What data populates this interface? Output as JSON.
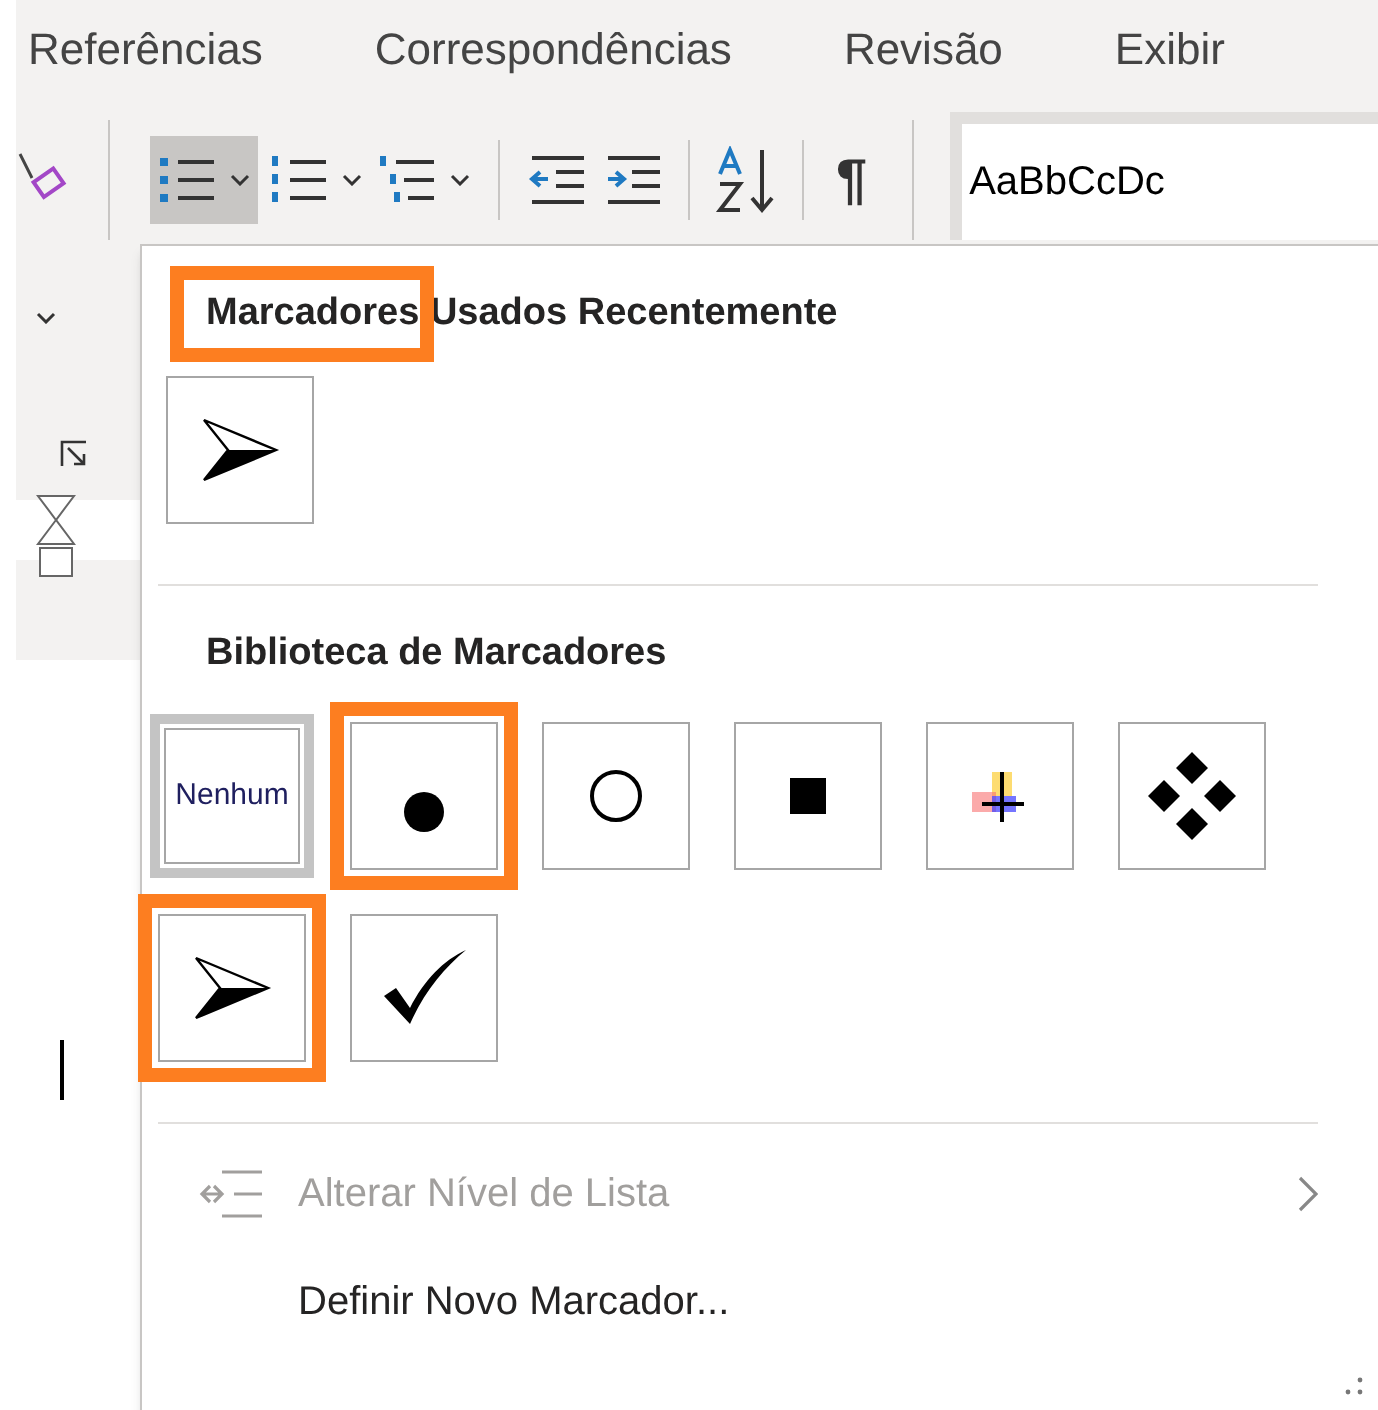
{
  "ribbon_tabs": [
    {
      "label": "Referências",
      "selected": false
    },
    {
      "label": "Correspondências",
      "selected": false
    },
    {
      "label": "Revisão",
      "selected": false
    },
    {
      "label": "Exibir",
      "selected": false
    }
  ],
  "toolbar": {
    "bullets_selected": true,
    "pilcrow": "¶",
    "style_preview": "AaBbCcDc"
  },
  "bullet_menu": {
    "recent": {
      "title": "Marcadores Usados Recentemente",
      "highlighted": true,
      "items": [
        {
          "kind": "arrow",
          "selected": false,
          "highlighted": false
        }
      ]
    },
    "library": {
      "title": "Biblioteca de Marcadores",
      "items": [
        {
          "kind": "none",
          "label": "Nenhum",
          "selected": true,
          "highlighted": false
        },
        {
          "kind": "dot",
          "selected": false,
          "highlighted": true
        },
        {
          "kind": "circle",
          "selected": false,
          "highlighted": false
        },
        {
          "kind": "square",
          "selected": false,
          "highlighted": false
        },
        {
          "kind": "plus",
          "selected": false,
          "highlighted": false
        },
        {
          "kind": "diamonds",
          "selected": false,
          "highlighted": false
        },
        {
          "kind": "arrow",
          "selected": false,
          "highlighted": true
        },
        {
          "kind": "check",
          "selected": false,
          "highlighted": false
        }
      ]
    },
    "commands": [
      {
        "label": "Alterar Nível de Lista",
        "disabled": true,
        "submenu": true
      },
      {
        "label": "Definir Novo Marcador...",
        "disabled": false,
        "submenu": false
      }
    ]
  }
}
